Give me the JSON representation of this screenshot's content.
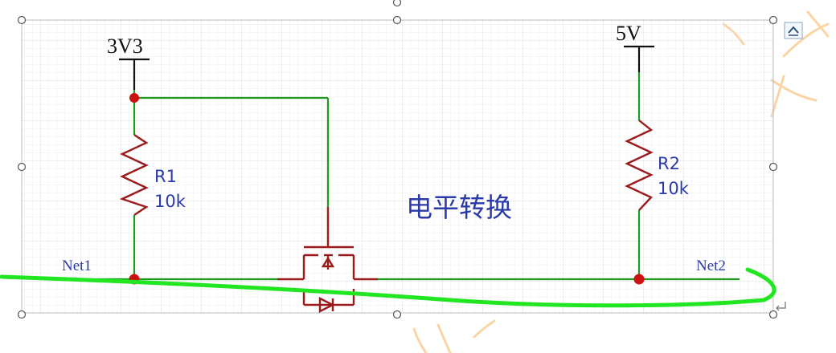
{
  "diagram": {
    "power_left": "3V3",
    "power_right": "5V",
    "r1_ref": "R1",
    "r1_value": "10k",
    "r2_ref": "R2",
    "r2_value": "10k",
    "title": "电平转换",
    "net_left": "Net1",
    "net_right": "Net2"
  },
  "colors": {
    "wire": "#1f9a1f",
    "component": "#9b1b1b",
    "junction": "#cc1111",
    "label": "#2a3aa8",
    "annotation": "#22e622",
    "watermark": "#f6a23a",
    "grid": "#e6e6e6"
  },
  "icons": {
    "corner_button": "collapse-icon",
    "return_mark": "return-arrow-icon"
  }
}
